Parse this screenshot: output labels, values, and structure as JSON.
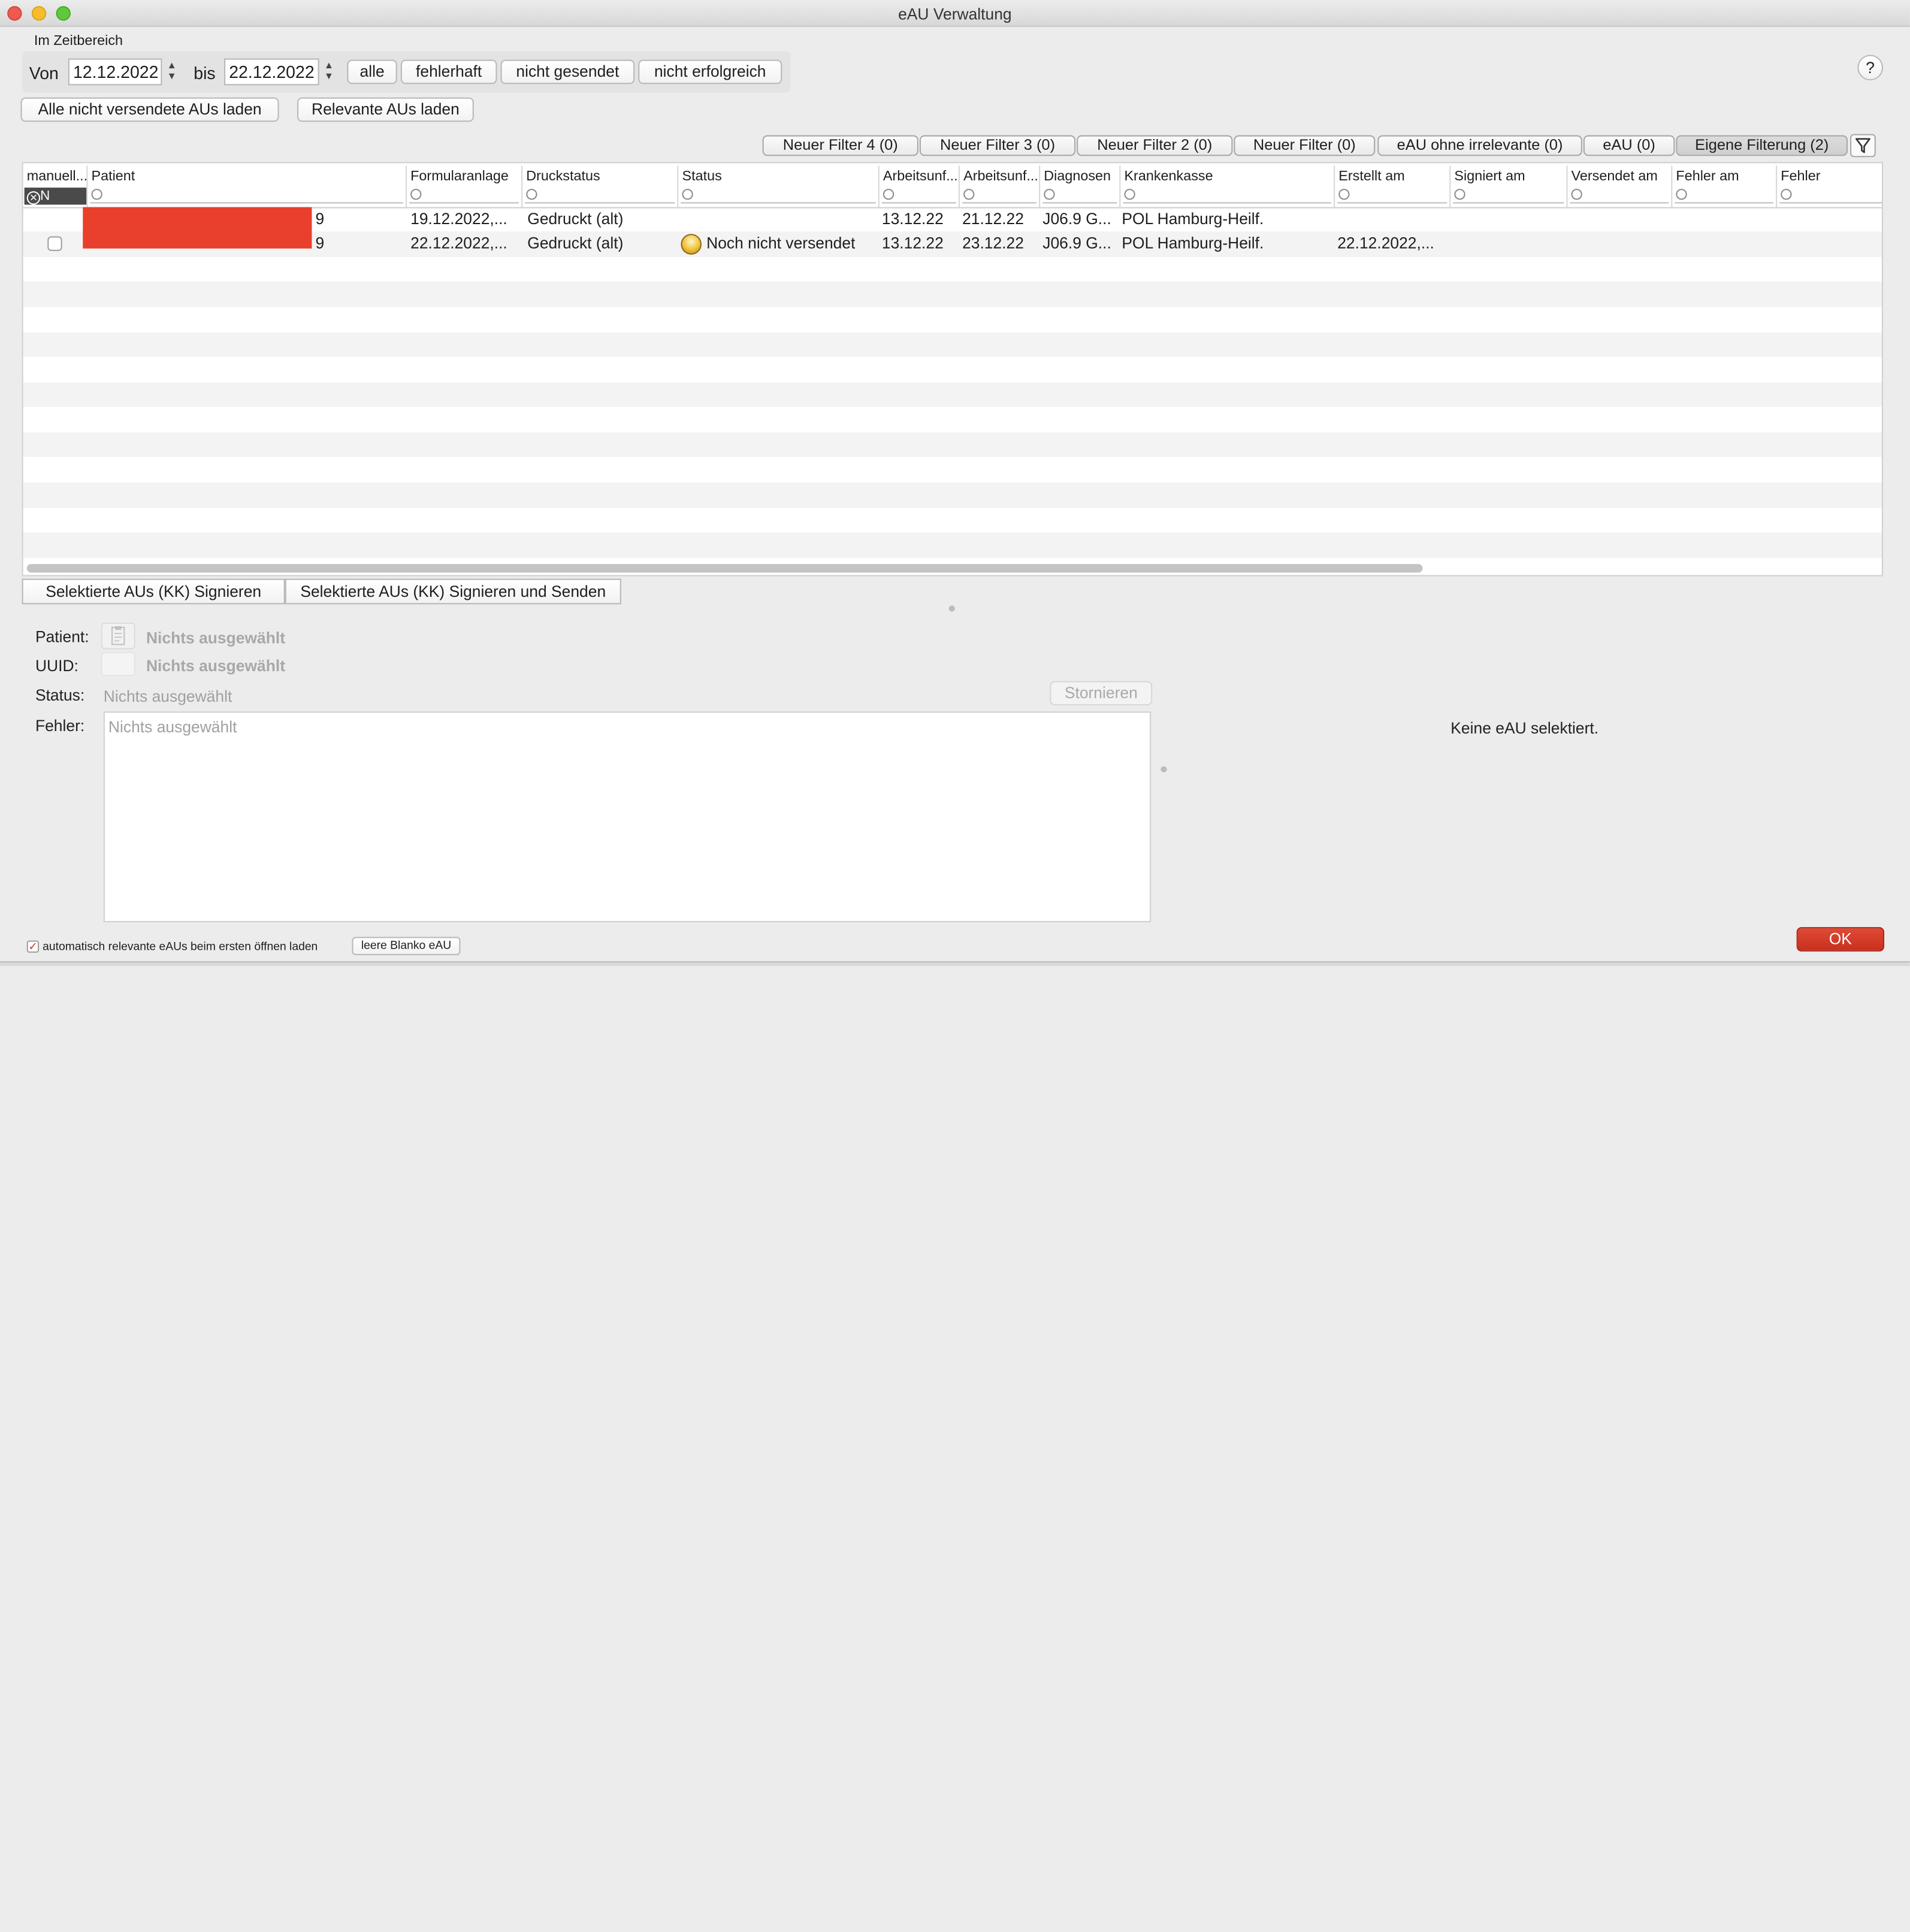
{
  "window": {
    "title": "eAU Verwaltung"
  },
  "range": {
    "group_label": "Im Zeitbereich",
    "from_label": "Von",
    "from_value": "12.12.2022",
    "to_label": "bis",
    "to_value": "22.12.2022",
    "buttons": [
      "alle",
      "fehlerhaft",
      "nicht gesendet",
      "nicht erfolgreich"
    ]
  },
  "help": "?",
  "load_buttons": {
    "all_unsent": "Alle nicht versendete AUs laden",
    "relevant": "Relevante AUs laden"
  },
  "filter_tabs": [
    "Neuer Filter 4 (0)",
    "Neuer Filter 3 (0)",
    "Neuer Filter 2 (0)",
    "Neuer Filter (0)",
    "eAU ohne irrelevante (0)",
    "eAU (0)",
    "Eigene Filterung (2)"
  ],
  "filter_icon": "funnel-icon",
  "table": {
    "columns": [
      "manuell...",
      "Patient",
      "Formularanlage",
      "Druckstatus",
      "Status",
      "Arbeitsunf...",
      "Arbeitsunf...",
      "Diagnosen",
      "Krankenkasse",
      "Erstellt am",
      "Signiert am",
      "Versendet am",
      "Fehler am",
      "Fehler"
    ],
    "manual_filter_value": "N",
    "rows": [
      {
        "patient": "9",
        "formular": "19.12.2022,...",
        "druck": "Gedruckt (alt)",
        "status": "",
        "au1": "13.12.22",
        "au2": "21.12.22",
        "diag": "J06.9 G...",
        "kasse": "POL Hamburg-Heilf.",
        "erstellt": ""
      },
      {
        "patient": "9",
        "formular": "22.12.2022,...",
        "druck": "Gedruckt (alt)",
        "status": "Noch nicht versendet",
        "au1": "13.12.22",
        "au2": "23.12.22",
        "diag": "J06.9 G...",
        "kasse": "POL Hamburg-Heilf.",
        "erstellt": "22.12.2022,..."
      }
    ],
    "redaction_color": "#e8402c"
  },
  "action_buttons": {
    "sign": "Selektierte AUs (KK) Signieren",
    "sign_send": "Selektierte AUs (KK) Signieren und Senden"
  },
  "detail": {
    "patient_label": "Patient:",
    "patient_value": "Nichts ausgewählt",
    "uuid_label": "UUID:",
    "uuid_value": "Nichts ausgewählt",
    "status_label": "Status:",
    "status_value": "Nichts ausgewählt",
    "cancel_button": "Stornieren",
    "error_label": "Fehler:",
    "error_placeholder": "Nichts ausgewählt",
    "right_message": "Keine eAU selektiert."
  },
  "footer": {
    "auto_load_label": "automatisch relevante eAUs beim ersten öffnen laden",
    "auto_load_checked": true,
    "blank_button": "leere Blanko eAU",
    "ok_button": "OK"
  }
}
